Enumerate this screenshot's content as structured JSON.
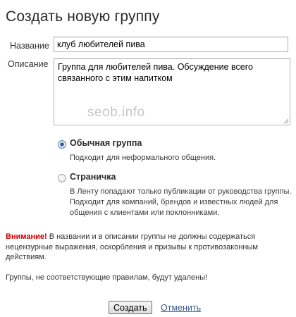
{
  "page": {
    "title": "Создать новую группу"
  },
  "form": {
    "name_label": "Название",
    "name_value": "клуб любителей пива",
    "description_label": "Описание",
    "description_value": "Группа для любителей пива. Обсуждение всего связанного с этим напитком"
  },
  "watermark": "seob.info",
  "group_types": [
    {
      "title": "Обычная группа",
      "description": "Подходит для неформального общения.",
      "selected": true
    },
    {
      "title": "Страничка",
      "description_lines": [
        "В Ленту попадают только публикации от руководства группы.",
        "Подходит для компаний, брендов и известных людей для",
        "общения с клиентами или поклонниками."
      ],
      "selected": false
    }
  ],
  "notice": {
    "warning_label": "Внимание!",
    "warning_text": " В названии и в описании группы не должны содержаться нецензурные выражения, оскорбления и призывы к противозаконным действиям.",
    "removal_text": "Группы, не соответствующие правилам, будут удалены!"
  },
  "actions": {
    "create_label": "Создать",
    "cancel_label": "Отменить"
  },
  "colors": {
    "warning": "#c00000",
    "link": "#3a5a8c",
    "radio_selected": "#2e5f93"
  },
  "icons": {
    "radio_selected": "radio-selected-icon",
    "radio_unselected": "radio-unselected-icon",
    "resize_grip": "resize-grip-icon"
  }
}
